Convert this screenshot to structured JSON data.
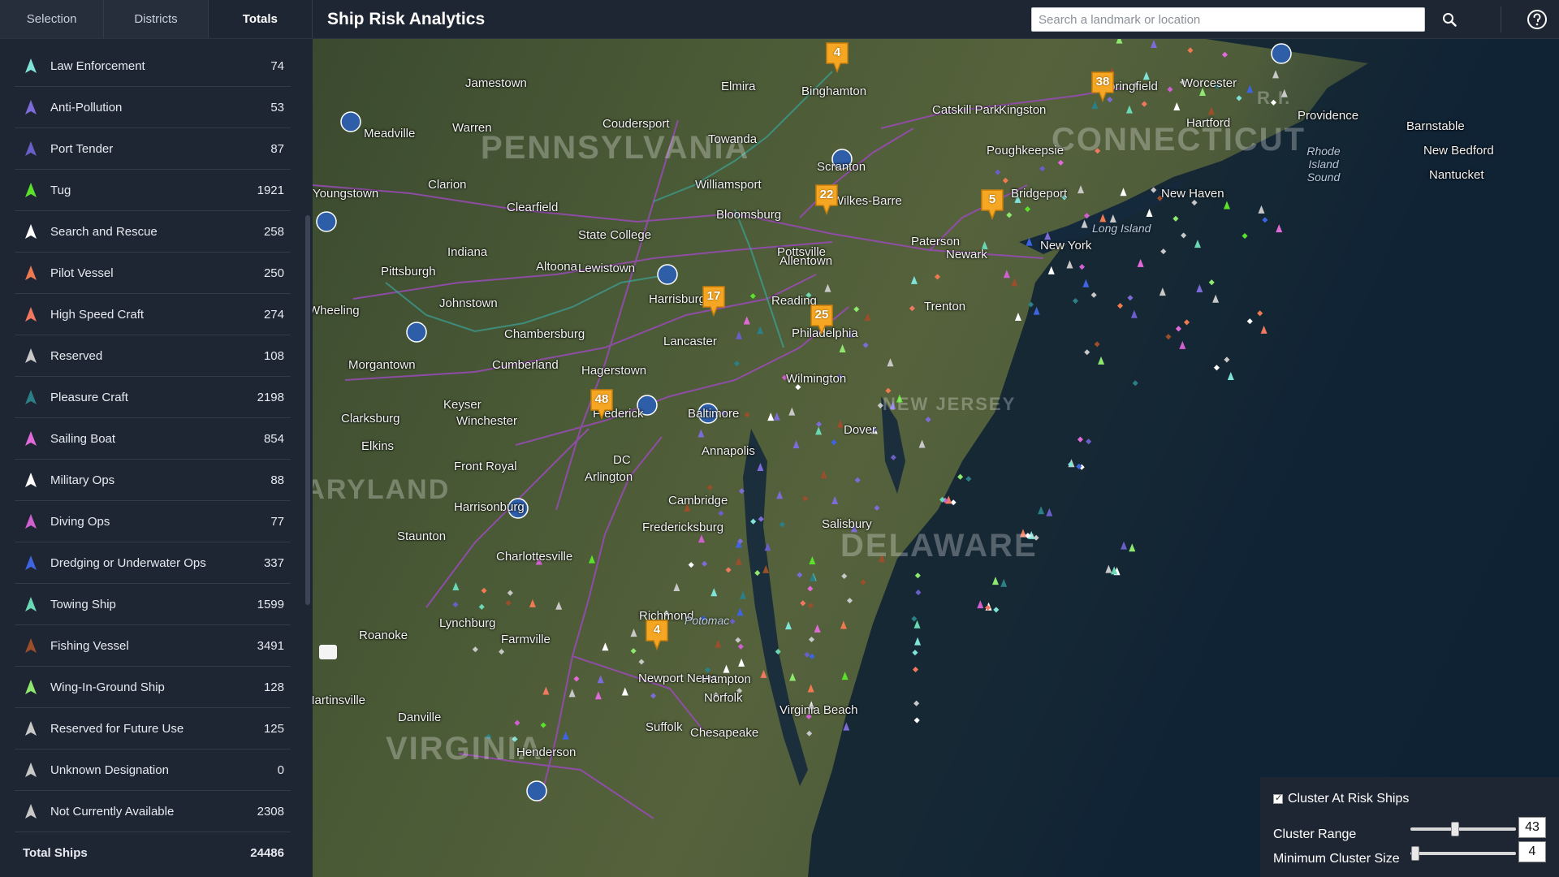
{
  "tabs": [
    {
      "label": "Selection",
      "active": false
    },
    {
      "label": "Districts",
      "active": false
    },
    {
      "label": "Totals",
      "active": true
    }
  ],
  "ship_types": [
    {
      "name": "Law Enforcement",
      "count": "74",
      "color": "#7fe3d8"
    },
    {
      "name": "Anti-Pollution",
      "count": "53",
      "color": "#7d6bd8"
    },
    {
      "name": "Port Tender",
      "count": "87",
      "color": "#6a5fc8"
    },
    {
      "name": "Tug",
      "count": "1921",
      "color": "#5be02c"
    },
    {
      "name": "Search and Rescue",
      "count": "258",
      "color": "#ffffff"
    },
    {
      "name": "Pilot Vessel",
      "count": "250",
      "color": "#f07a50"
    },
    {
      "name": "High Speed Craft",
      "count": "274",
      "color": "#f27860"
    },
    {
      "name": "Reserved",
      "count": "108",
      "color": "#c8c8c8"
    },
    {
      "name": "Pleasure Craft",
      "count": "2198",
      "color": "#2c7f86"
    },
    {
      "name": "Sailing Boat",
      "count": "854",
      "color": "#e26ad8"
    },
    {
      "name": "Military Ops",
      "count": "88",
      "color": "#ffffff"
    },
    {
      "name": "Diving Ops",
      "count": "77",
      "color": "#d060d0"
    },
    {
      "name": "Dredging or Underwater Ops",
      "count": "337",
      "color": "#3e64e0"
    },
    {
      "name": "Towing Ship",
      "count": "1599",
      "color": "#6ad8b4"
    },
    {
      "name": "Fishing Vessel",
      "count": "3491",
      "color": "#9b4e2a"
    },
    {
      "name": "Wing-In-Ground Ship",
      "count": "128",
      "color": "#8ee86e"
    },
    {
      "name": "Reserved for Future Use",
      "count": "125",
      "color": "#c8c8c8"
    },
    {
      "name": "Unknown Designation",
      "count": "0",
      "color": "#c8c8c8"
    },
    {
      "name": "Not Currently Available",
      "count": "2308",
      "color": "#c8c8c8"
    }
  ],
  "total": {
    "label": "Total Ships",
    "count": "24486"
  },
  "header": {
    "title": "Ship Risk Analytics",
    "search_placeholder": "Search a landmark or location",
    "search_icon": "search-icon",
    "help_icon": "help-icon"
  },
  "map": {
    "states": [
      "PENNSYLVANIA",
      "CONNECTICUT",
      "NEW JERSEY",
      "DELAWARE",
      "VIRGINIA",
      "MARYLAND",
      "R.I."
    ],
    "places": [
      "Jamestown",
      "Elmira",
      "Binghamton",
      "Springfield",
      "Worcester",
      "Providence",
      "Barnstable",
      "Meadville",
      "Warren",
      "Coudersport",
      "Towanda",
      "Catskill Park",
      "Kingston",
      "Hartford",
      "New Bedford",
      "Nantucket",
      "Clarion",
      "Williamsport",
      "Scranton",
      "Poughkeepsie",
      "Youngstown",
      "Clearfield",
      "Bloomsburg",
      "Wilkes-Barre",
      "Bridgeport",
      "New Haven",
      "Indiana",
      "State College",
      "Pottsville",
      "Paterson",
      "Newark",
      "New York",
      "Pittsburgh",
      "Altoona",
      "Lewistown",
      "Allentown",
      "Johnstown",
      "Harrisburg",
      "Reading",
      "Trenton",
      "Wheeling",
      "Chambersburg",
      "Lancaster",
      "Philadelphia",
      "Morgantown",
      "Cumberland",
      "Hagerstown",
      "Wilmington",
      "Keyser",
      "Frederick",
      "Baltimore",
      "Clarksburg",
      "Winchester",
      "Dover",
      "Elkins",
      "Front Royal",
      "Annapolis",
      "Arlington",
      "DC",
      "Cambridge",
      "Harrisonburg",
      "Fredericksburg",
      "Salisbury",
      "Staunton",
      "Charlottesville",
      "Richmond",
      "Lynchburg",
      "Farmville",
      "Roanoke",
      "Newport News",
      "Hampton",
      "Norfolk",
      "Virginia Beach",
      "Suffolk",
      "Chesapeake",
      "Danville",
      "Martinsville",
      "Henderson"
    ],
    "water": [
      "Long Island",
      "Rhode Island Sound",
      "Potomac"
    ],
    "clusters": [
      "4",
      "38",
      "22",
      "5",
      "17",
      "25",
      "48",
      "4"
    ]
  },
  "cluster_panel": {
    "checkbox_label": "Cluster At Risk Ships",
    "checked": true,
    "range_label": "Cluster Range",
    "range_value": "43",
    "min_size_label": "Minimum Cluster Size",
    "min_size_value": "4"
  }
}
